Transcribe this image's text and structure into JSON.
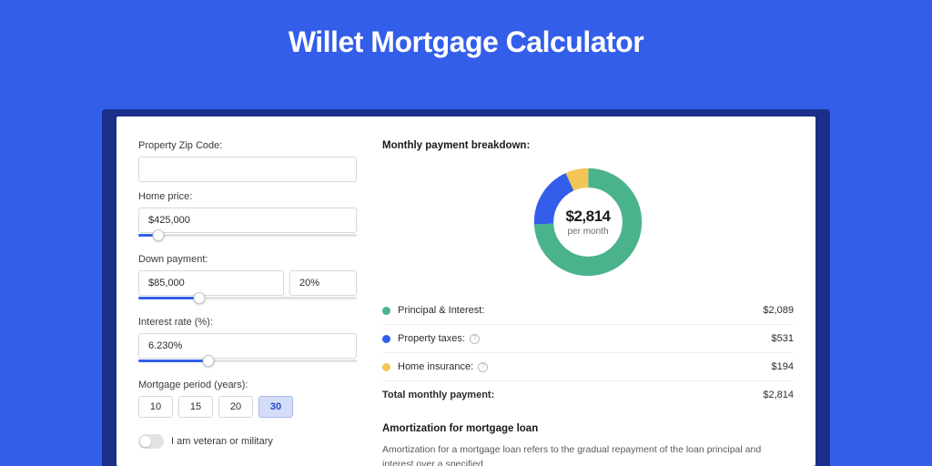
{
  "title": "Willet Mortgage Calculator",
  "colors": {
    "accent": "#335eea",
    "principal": "#4bb38b",
    "taxes": "#335eea",
    "insurance": "#f2c557"
  },
  "form": {
    "zip": {
      "label": "Property Zip Code:",
      "value": ""
    },
    "home_price": {
      "label": "Home price:",
      "value": "$425,000",
      "slider_pct": 9
    },
    "down_payment": {
      "label": "Down payment:",
      "amount": "$85,000",
      "percent": "20%",
      "slider_pct": 28
    },
    "interest_rate": {
      "label": "Interest rate (%):",
      "value": "6.230%",
      "slider_pct": 32
    },
    "period": {
      "label": "Mortgage period (years):",
      "options": [
        "10",
        "15",
        "20",
        "30"
      ],
      "selected": "30"
    },
    "veteran": {
      "label": "I am veteran or military",
      "on": false
    }
  },
  "breakdown": {
    "title": "Monthly payment breakdown:",
    "center_value": "$2,814",
    "center_sub": "per month",
    "rows": [
      {
        "label": "Principal & Interest:",
        "value": "$2,089",
        "color": "#4bb38b",
        "info": false
      },
      {
        "label": "Property taxes:",
        "value": "$531",
        "color": "#335eea",
        "info": true
      },
      {
        "label": "Home insurance:",
        "value": "$194",
        "color": "#f2c557",
        "info": true
      }
    ],
    "total": {
      "label": "Total monthly payment:",
      "value": "$2,814"
    }
  },
  "amort": {
    "title": "Amortization for mortgage loan",
    "text": "Amortization for a mortgage loan refers to the gradual repayment of the loan principal and interest over a specified"
  },
  "chart_data": {
    "type": "pie",
    "title": "Monthly payment breakdown:",
    "categories": [
      "Principal & Interest",
      "Property taxes",
      "Home insurance"
    ],
    "values": [
      2089,
      531,
      194
    ],
    "colors": [
      "#4bb38b",
      "#335eea",
      "#f2c557"
    ],
    "total": 2814,
    "center_label": "$2,814 per month"
  }
}
